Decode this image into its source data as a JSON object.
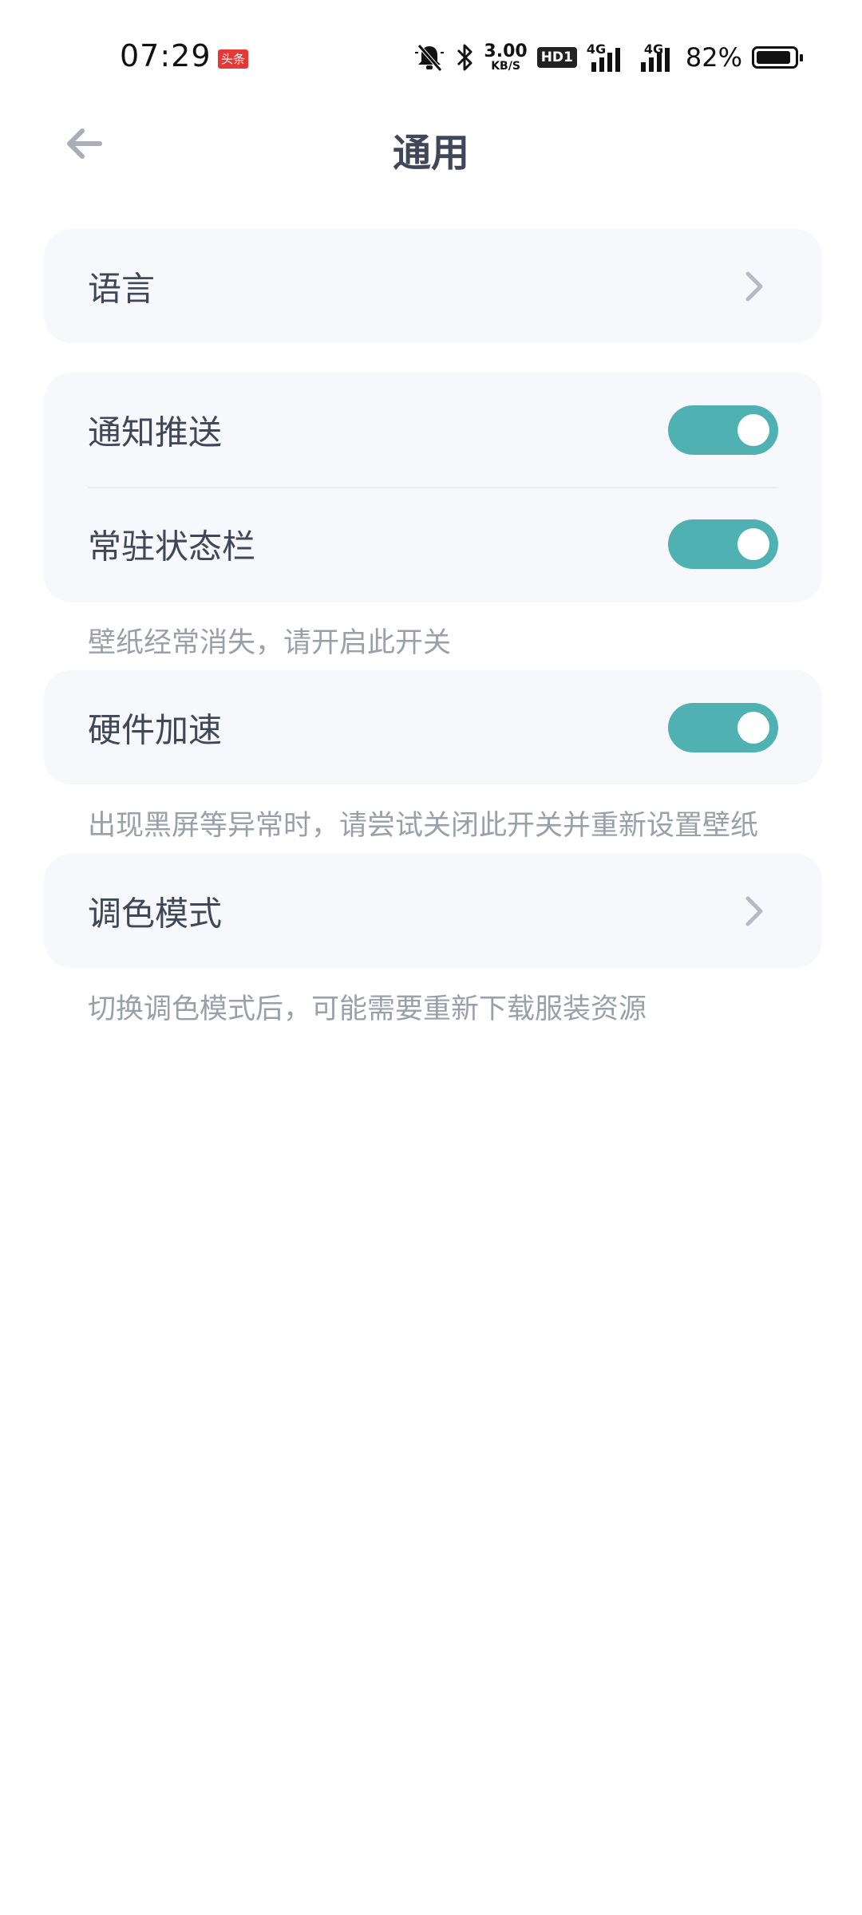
{
  "status_bar": {
    "time": "07:29",
    "app_badge": "头条",
    "net_speed_value": "3.00",
    "net_speed_unit": "KB/S",
    "hd_label": "HD1",
    "signal1_label": "4G",
    "signal2_label": "4G",
    "battery_percent": "82%",
    "battery_level": 0.82
  },
  "header": {
    "title": "通用"
  },
  "settings": {
    "language": {
      "label": "语言"
    },
    "notification_push": {
      "label": "通知推送",
      "enabled": true
    },
    "resident_statusbar": {
      "label": "常驻状态栏",
      "enabled": true,
      "hint": "壁纸经常消失，请开启此开关"
    },
    "hardware_accel": {
      "label": "硬件加速",
      "enabled": true,
      "hint": "出现黑屏等异常时，请尝试关闭此开关并重新设置壁纸"
    },
    "color_mode": {
      "label": "调色模式",
      "hint": "切换调色模式后，可能需要重新下载服装资源"
    }
  },
  "colors": {
    "toggle_on": "#4fb1b1",
    "card_bg": "#f6f8fc",
    "text_primary": "#3f4758",
    "text_hint": "#9aa0aa"
  },
  "icons": [
    "back-arrow-icon",
    "chevron-right-icon",
    "mute-icon",
    "bluetooth-icon",
    "signal-icon",
    "battery-icon"
  ]
}
